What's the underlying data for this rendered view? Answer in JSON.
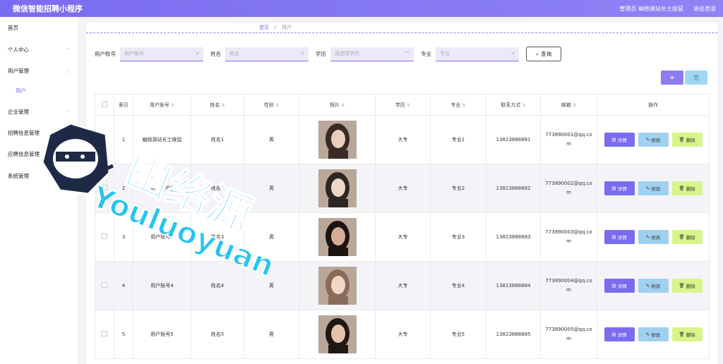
{
  "header": {
    "title": "微信智能招聘小程序",
    "admin": "管理员 幽络源站长士拨鼠",
    "logout": "退出登录"
  },
  "sidebar": {
    "items": [
      {
        "label": "首页",
        "chevron": false
      },
      {
        "label": "个人中心",
        "chevron": true
      },
      {
        "label": "用户管理",
        "chevron": true
      },
      {
        "label": "企业管理",
        "chevron": true
      },
      {
        "label": "招聘信息管理",
        "chevron": true
      },
      {
        "label": "应聘信息管理",
        "chevron": true
      },
      {
        "label": "系统管理",
        "chevron": true
      }
    ],
    "sub_item": "用户"
  },
  "breadcrumb": {
    "home": "首页",
    "current": "用户"
  },
  "search": {
    "account_label": "用户账号",
    "account_placeholder": "用户账号",
    "name_label": "姓名",
    "name_placeholder": "姓名",
    "edu_label": "学历",
    "edu_placeholder": "请选择学历",
    "major_label": "专业",
    "major_placeholder": "专业",
    "query_label": "查询"
  },
  "actions": {
    "add": "+",
    "delete": "🗑"
  },
  "table": {
    "headers": [
      "索引",
      "用户账号",
      "姓名",
      "性别",
      "照片",
      "学历",
      "专业",
      "联系方式",
      "邮箱",
      "操作"
    ],
    "rows": [
      {
        "index": "1",
        "account": "幽络源站长士拨鼠",
        "name": "姓名1",
        "gender": "男",
        "edu": "大专",
        "major": "专业1",
        "phone": "13823888881",
        "email1": "773890001@qq.co",
        "email2": "m"
      },
      {
        "index": "2",
        "account": "用户账号2",
        "name": "姓名2",
        "gender": "男",
        "edu": "大专",
        "major": "专业2",
        "phone": "13823888882",
        "email1": "773890002@qq.co",
        "email2": "m"
      },
      {
        "index": "3",
        "account": "用户账号3",
        "name": "姓名3",
        "gender": "男",
        "edu": "大专",
        "major": "专业3",
        "phone": "13823888883",
        "email1": "773890003@qq.co",
        "email2": "m"
      },
      {
        "index": "4",
        "account": "用户账号4",
        "name": "姓名4",
        "gender": "男",
        "edu": "大专",
        "major": "专业4",
        "phone": "13823888884",
        "email1": "773890004@qq.co",
        "email2": "m"
      },
      {
        "index": "5",
        "account": "用户账号5",
        "name": "姓名5",
        "gender": "男",
        "edu": "大专",
        "major": "专业5",
        "phone": "13823888885",
        "email1": "773890005@qq.co",
        "email2": "m"
      }
    ],
    "btn_detail": "详情",
    "btn_edit": "修改",
    "btn_delete": "删除"
  },
  "watermark": {
    "cn": "幽络源",
    "en": "Youluoyuan"
  },
  "colors": {
    "accent": "#7a6cf0",
    "edit": "#9fd0f0",
    "remove": "#d9f58a",
    "watermark": "#27c4f0"
  }
}
